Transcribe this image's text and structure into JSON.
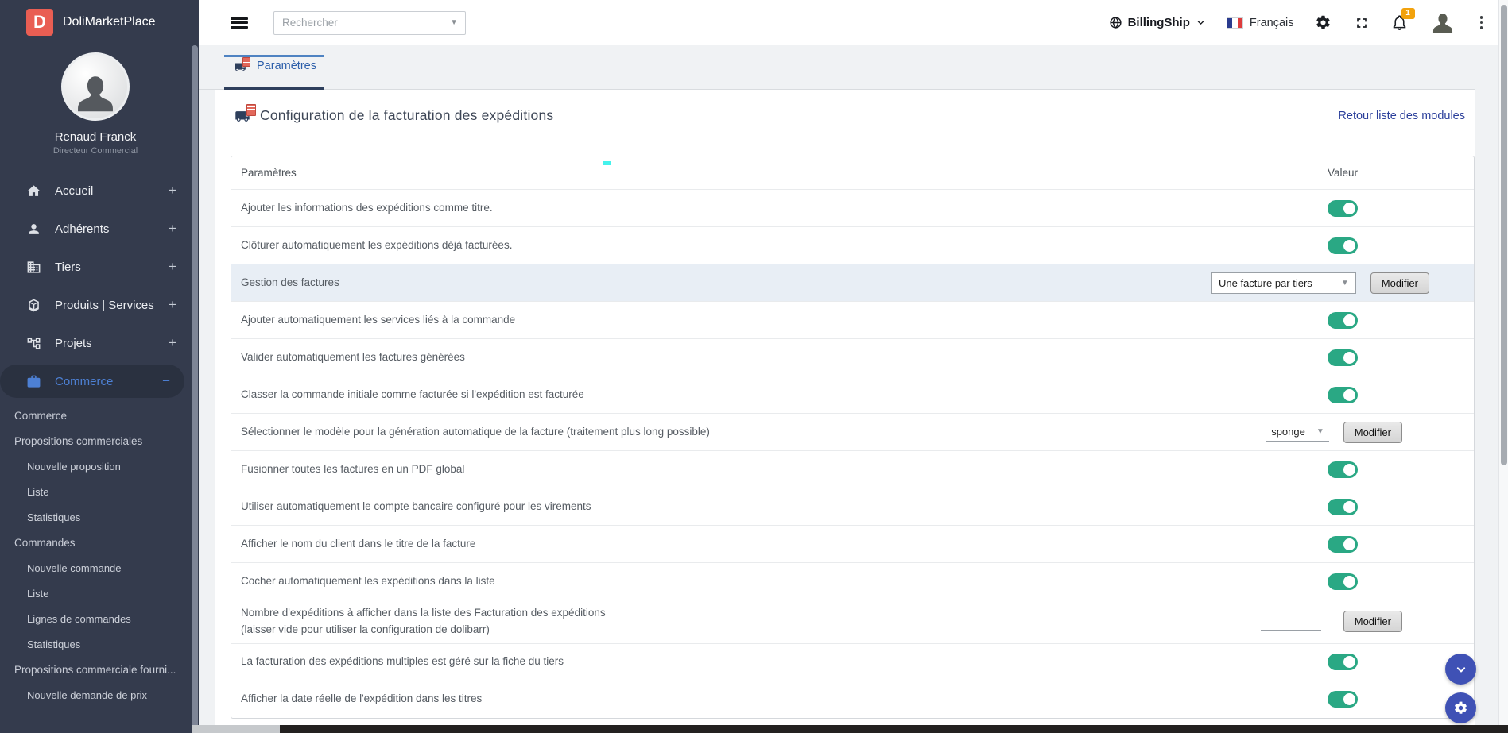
{
  "app": {
    "logo_letter": "D",
    "brand": "DoliMarketPlace"
  },
  "sidebar": {
    "user": {
      "name": "Renaud Franck",
      "role": "Directeur Commercial"
    },
    "items": [
      {
        "label": "Accueil",
        "icon": "home",
        "expander": "+",
        "active": false
      },
      {
        "label": "Adhérents",
        "icon": "person",
        "expander": "+",
        "active": false
      },
      {
        "label": "Tiers",
        "icon": "building",
        "expander": "+",
        "active": false
      },
      {
        "label": "Produits | Services",
        "icon": "cube",
        "expander": "+",
        "active": false
      },
      {
        "label": "Projets",
        "icon": "tree",
        "expander": "+",
        "active": false
      },
      {
        "label": "Commerce",
        "icon": "briefcase",
        "expander": "−",
        "active": true
      }
    ],
    "submenu": [
      {
        "label": "Commerce",
        "level": 1
      },
      {
        "label": "Propositions commerciales",
        "level": 1
      },
      {
        "label": "Nouvelle proposition",
        "level": 2
      },
      {
        "label": "Liste",
        "level": 2
      },
      {
        "label": "Statistiques",
        "level": 2
      },
      {
        "label": "Commandes",
        "level": 1
      },
      {
        "label": "Nouvelle commande",
        "level": 2
      },
      {
        "label": "Liste",
        "level": 2
      },
      {
        "label": "Lignes de commandes",
        "level": 2
      },
      {
        "label": "Statistiques",
        "level": 2
      },
      {
        "label": "Propositions commerciale fourni...",
        "level": 1
      },
      {
        "label": "Nouvelle demande de prix",
        "level": 2
      }
    ]
  },
  "topbar": {
    "search_placeholder": "Rechercher",
    "company": "BillingShip",
    "language": "Français",
    "notification_count": "1"
  },
  "tab": {
    "label": "Paramètres"
  },
  "page": {
    "title": "Configuration de la facturation des expéditions",
    "back_link": "Retour liste des modules"
  },
  "table": {
    "header_param": "Paramètres",
    "header_value": "Valeur",
    "modify_label": "Modifier",
    "rows": [
      {
        "label": "Ajouter les informations des expéditions comme titre.",
        "control": "toggle",
        "state": "on"
      },
      {
        "label": "Clôturer automatiquement les expéditions déjà facturées.",
        "control": "toggle",
        "state": "on"
      },
      {
        "label": "Gestion des factures",
        "control": "select_button",
        "value": "Une facture par tiers",
        "highlight": true
      },
      {
        "label": "Ajouter automatiquement les services liés à la commande",
        "control": "toggle",
        "state": "on"
      },
      {
        "label": "Valider automatiquement les factures générées",
        "control": "toggle",
        "state": "on"
      },
      {
        "label": "Classer la commande initiale comme facturée si l'expédition est facturée",
        "control": "toggle",
        "state": "on"
      },
      {
        "label": "Sélectionner le modèle pour la génération automatique de la facture (traitement plus long possible)",
        "control": "inline_select_button",
        "value": "sponge"
      },
      {
        "label": "Fusionner toutes les factures en un PDF global",
        "control": "toggle",
        "state": "on"
      },
      {
        "label": "Utiliser automatiquement le compte bancaire configuré pour les virements",
        "control": "toggle",
        "state": "on"
      },
      {
        "label": "Afficher le nom du client dans le titre de la facture",
        "control": "toggle",
        "state": "on"
      },
      {
        "label": "Cocher automatiquement les expéditions dans la liste",
        "control": "toggle",
        "state": "on"
      },
      {
        "label": "Nombre d'expéditions à afficher dans la liste des Facturation des expéditions",
        "label_line2": "(laisser vide pour utiliser la configuration de dolibarr)",
        "control": "input_button",
        "value": ""
      },
      {
        "label": "La facturation des expéditions multiples est géré sur la fiche du tiers",
        "control": "toggle",
        "state": "on"
      },
      {
        "label": "Afficher la date réelle de l'expédition dans les titres",
        "control": "toggle",
        "state": "on"
      }
    ]
  },
  "colors": {
    "sidebar_bg": "#343b4d",
    "logo_red": "#e95e53",
    "active_item_blue": "#4d80d4",
    "tab_blue": "#2d5faa",
    "tab_underline_navy": "#2e3f5c",
    "toggle_green": "#2aa884",
    "row_highlight": "#e8eef5",
    "fab_indigo": "#3f51b5",
    "badge_orange": "#f2a20d",
    "link_navy": "#2b3f9b"
  }
}
